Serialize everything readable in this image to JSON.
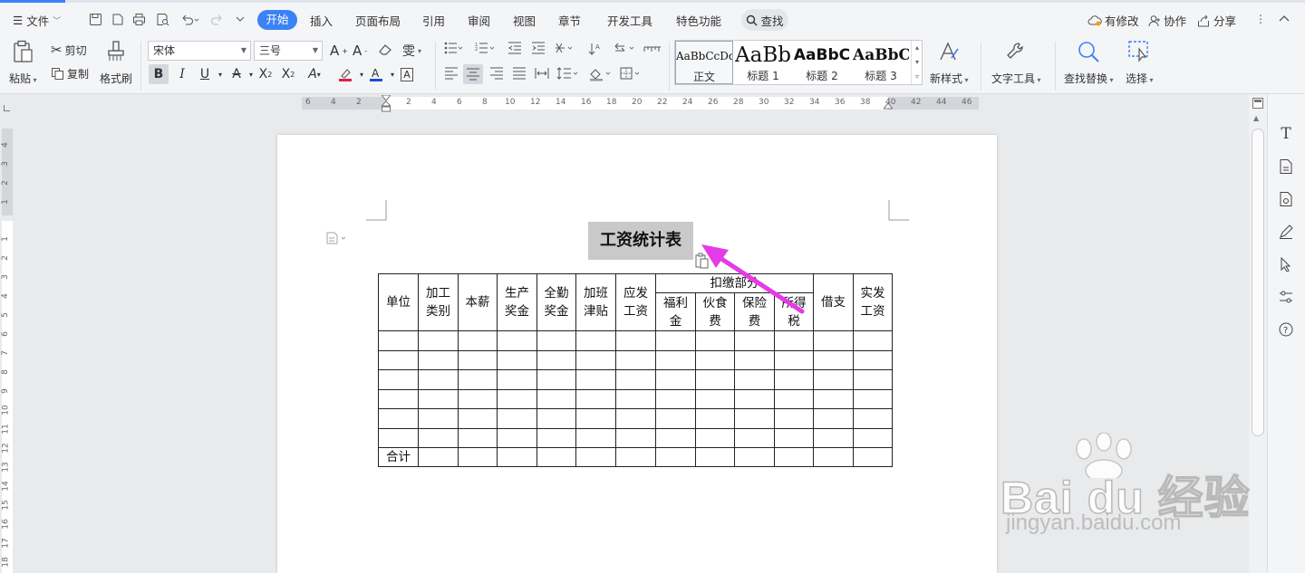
{
  "menubar": {
    "file_label": "文件",
    "tabs": [
      "开始",
      "插入",
      "页面布局",
      "引用",
      "审阅",
      "视图",
      "章节",
      "开发工具",
      "特色功能"
    ],
    "search_label": "查找",
    "has_changes_label": "有修改",
    "collab_label": "协作",
    "share_label": "分享"
  },
  "ribbon": {
    "paste_label": "粘贴",
    "cut_label": "剪切",
    "copy_label": "复制",
    "format_painter_label": "格式刷",
    "font_name": "宋体",
    "font_size": "三号",
    "bold": "B",
    "italic": "I",
    "underline": "U",
    "styles": [
      {
        "sample": "AaBbCcDd",
        "name": "正文"
      },
      {
        "sample": "AaBb",
        "name": "标题 1"
      },
      {
        "sample": "AaBbC",
        "name": "标题 2"
      },
      {
        "sample": "AaBbC",
        "name": "标题 3"
      }
    ],
    "new_style_label": "新样式",
    "text_tools_label": "文字工具",
    "find_replace_label": "查找替换",
    "select_label": "选择"
  },
  "hruler": {
    "left_numbers": [
      "6",
      "4",
      "2"
    ],
    "right_numbers": [
      "2",
      "4",
      "6",
      "8",
      "10",
      "12",
      "14",
      "16",
      "18",
      "20",
      "22",
      "24",
      "26",
      "28",
      "30",
      "32",
      "34",
      "36",
      "38",
      "40",
      "42",
      "44",
      "46"
    ]
  },
  "vruler": {
    "top_numbers": [
      "4",
      "3",
      "2",
      "1"
    ],
    "numbers": [
      "1",
      "2",
      "3",
      "4",
      "5",
      "6",
      "7",
      "8",
      "9",
      "10",
      "11",
      "12",
      "13",
      "14",
      "15",
      "16",
      "17",
      "18"
    ]
  },
  "document": {
    "title": "工资统计表",
    "table": {
      "unit": "单位",
      "process_type": [
        "加工",
        "类别"
      ],
      "base_salary": "本薪",
      "production_bonus": [
        "生产",
        "奖金"
      ],
      "attendance_bonus": [
        "全勤",
        "奖金"
      ],
      "overtime_allowance": [
        "加班",
        "津贴"
      ],
      "payable_salary": [
        "应发",
        "工资"
      ],
      "deductions": "扣缴部分",
      "welfare_fee": [
        "福利",
        "金"
      ],
      "meal_fee": [
        "伙食",
        "费"
      ],
      "insurance_fee": [
        "保险",
        "费"
      ],
      "income_tax": [
        "所得",
        "税"
      ],
      "advance": "借支",
      "net_salary": [
        "实发",
        "工资"
      ],
      "total": "合计"
    }
  },
  "watermark": {
    "brand": "Bai du 经验",
    "url": "jingyan.baidu.com"
  },
  "colors": {
    "accent": "#3b82f6",
    "arrow": "#e53be6",
    "title_highlight": "#c9c9c9"
  }
}
